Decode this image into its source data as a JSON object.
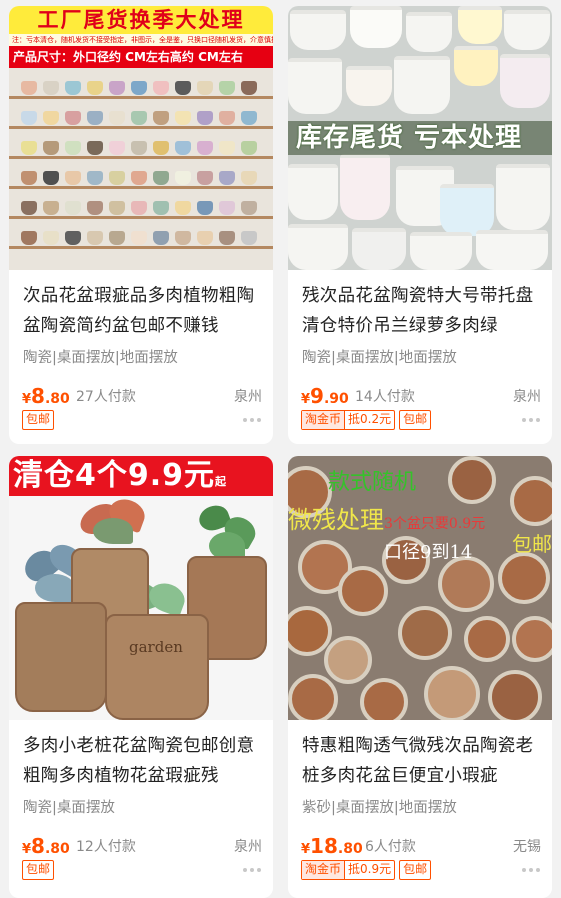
{
  "products": [
    {
      "image_text": {
        "banner": "工厂尾货换季大处理",
        "sub": "注：亏本清仓，随机发货不接受指定，非图示，全是鉴，只换口径随机发货，介意慎拍！",
        "size": "产品尺寸：外口径约   CM左右高约   CM左右"
      },
      "title": "次品花盆瑕疵品多肉植物粗陶盆陶瓷简约盆包邮不赚钱",
      "tags": "陶瓷|桌面摆放|地面摆放",
      "price_yen": "¥",
      "price_int": "8",
      "price_dec": ".80",
      "sold": "27人付款",
      "location": "泉州",
      "badges": [
        "包邮"
      ]
    },
    {
      "image_text": {
        "ribbon": "库存尾货 亏本处理"
      },
      "title": "残次品花盆陶瓷特大号带托盘清仓特价吊兰绿萝多肉绿",
      "tags": "陶瓷|桌面摆放|地面摆放",
      "price_yen": "¥",
      "price_int": "9",
      "price_dec": ".90",
      "sold": "14人付款",
      "location": "泉州",
      "coin_label": "淘金币",
      "coin_value": "抵0.2元",
      "badges": [
        "包邮"
      ]
    },
    {
      "image_text": {
        "banner_main": "清仓4个9.9元",
        "banner_suffix": "起",
        "pot_text": "garden"
      },
      "title": "多肉小老桩花盆陶瓷包邮创意粗陶多肉植物花盆瑕疵残",
      "tags": "陶瓷|桌面摆放",
      "price_yen": "¥",
      "price_int": "8",
      "price_dec": ".80",
      "sold": "12人付款",
      "location": "泉州",
      "badges": [
        "包邮"
      ]
    },
    {
      "image_text": {
        "line1": "款式随机",
        "line2": "微残处理",
        "line2_red": "3个盆只要0.9元",
        "line3": "口径9到14",
        "line4": "包邮"
      },
      "title": "特惠粗陶透气微残次品陶瓷老桩多肉花盆巨便宜小瑕疵",
      "tags": "紫砂|桌面摆放|地面摆放",
      "price_yen": "¥",
      "price_int": "18",
      "price_dec": ".80",
      "sold": "6人付款",
      "location": "无锡",
      "coin_label": "淘金币",
      "coin_value": "抵0.9元",
      "badges": [
        "包邮"
      ]
    }
  ],
  "colors": {
    "price": "#ff5000",
    "background": "#f2f2f2",
    "card": "#ffffff"
  }
}
